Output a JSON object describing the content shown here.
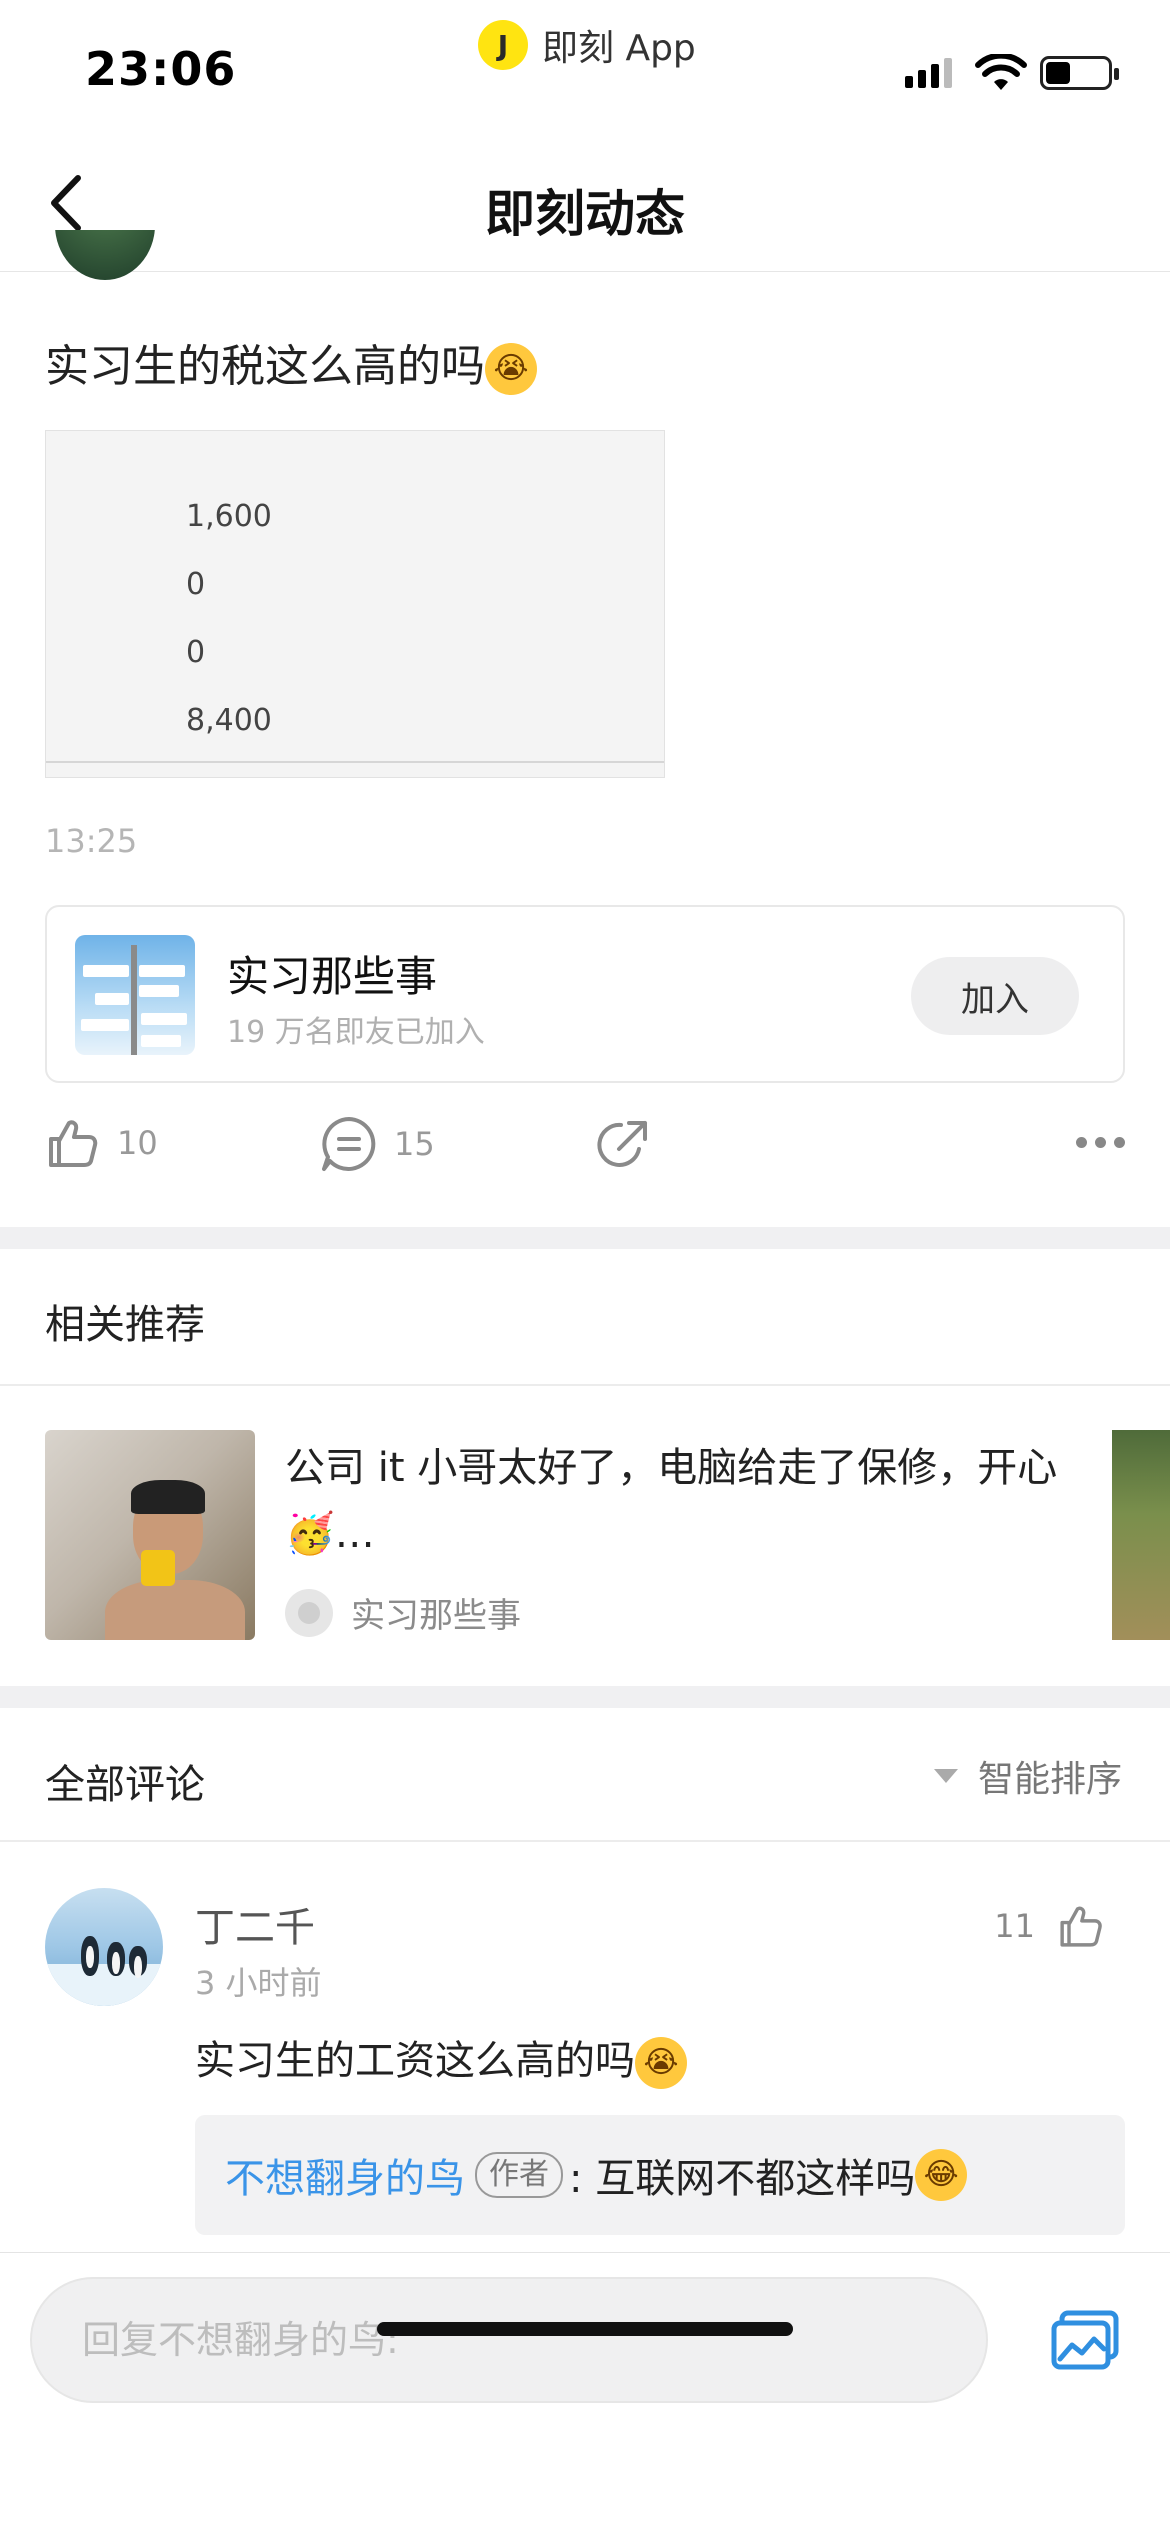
{
  "status_bar": {
    "time": "23:06",
    "app_name": "即刻 App",
    "app_logo": "J",
    "battery_level": 0.35
  },
  "nav": {
    "title": "即刻动态"
  },
  "post": {
    "text": "实习生的税这么高的吗",
    "emoji": "crying-face-emoji",
    "image_values": [
      "1,600",
      "0",
      "0",
      "8,400"
    ],
    "time": "13:25",
    "topic": {
      "name": "实习那些事",
      "members": "19 万名即友已加入",
      "join_label": "加入"
    },
    "likes": "10",
    "comments": "15"
  },
  "related": {
    "title": "相关推荐",
    "items": [
      {
        "text": "公司 it 小哥太好了，电脑给走了保修，开心 🥳…",
        "topic": "实习那些事"
      }
    ]
  },
  "comments_section": {
    "title": "全部评论",
    "sort_label": "智能排序",
    "comments": [
      {
        "name": "丁二千",
        "time": "3 小时前",
        "likes": "11",
        "text": "实习生的工资这么高的吗",
        "reply": {
          "who": "不想翻身的鸟",
          "badge": "作者",
          "text": ": 互联网不都这样吗"
        }
      }
    ]
  },
  "input": {
    "placeholder": "回复不想翻身的鸟:"
  },
  "colors": {
    "accent_yellow": "#FFE411",
    "link_blue": "#3a94e8"
  }
}
